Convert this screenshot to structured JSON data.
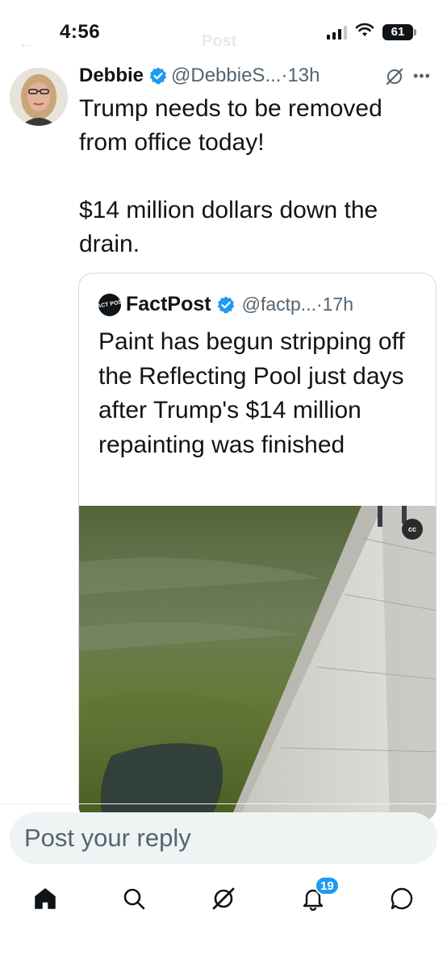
{
  "status_bar": {
    "time": "4:56",
    "battery": "61"
  },
  "header": {
    "title": "Post"
  },
  "tweet": {
    "author_name": "Debbie",
    "handle_time": "@DebbieS...·13h",
    "text_line_1": "Trump needs to be removed from office today!",
    "text_line_2": "$14 million dollars down the drain."
  },
  "quote": {
    "logo_text": "FACT POST",
    "author_name": "FactPost",
    "handle_time": "@factp...·17h",
    "text": "Paint has begun stripping off the Reflecting Pool just days after Trump's $14 million repainting was finished",
    "media_badge": "cc"
  },
  "reply": {
    "placeholder": "Post your reply"
  },
  "nav": {
    "items": [
      "home-icon",
      "search-icon",
      "grok-icon",
      "notifications-icon",
      "messages-icon"
    ],
    "notifications_badge": "19"
  },
  "colors": {
    "accent": "#1d9bf0",
    "text_primary": "#0f1419",
    "text_secondary": "#536471",
    "border": "#cfd9de"
  }
}
